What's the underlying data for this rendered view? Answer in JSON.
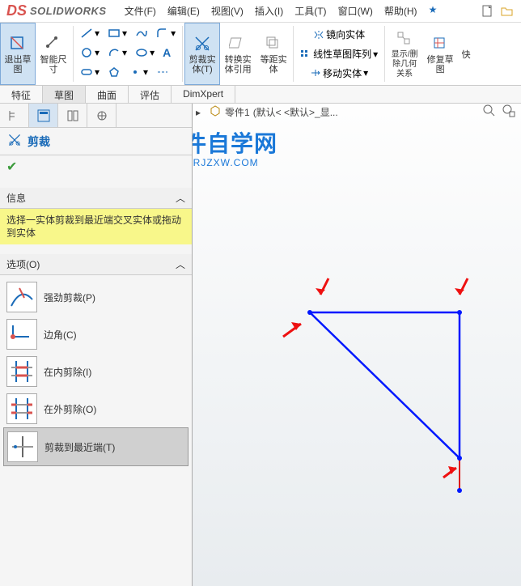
{
  "app": {
    "brand": "SOLIDWORKS"
  },
  "menu": {
    "file": "文件(F)",
    "edit": "编辑(E)",
    "view": "视图(V)",
    "insert": "插入(I)",
    "tools": "工具(T)",
    "window": "窗口(W)",
    "help": "帮助(H)"
  },
  "ribbon": {
    "exit_sketch": "退出草\n图",
    "smart_dim": "智能尺\n寸",
    "trim": "剪裁实\n体(T)",
    "convert": "转换实\n体引用",
    "offset": "等距实\n体",
    "mirror": "镜向实体",
    "linpattern": "线性草图阵列",
    "move": "移动实体",
    "showhide": "显示/删\n除几何\n关系",
    "repair": "修复草\n图",
    "fast": "快"
  },
  "tabs": {
    "feature": "特征",
    "sketch": "草图",
    "surface": "曲面",
    "evaluate": "评估",
    "dimxpert": "DimXpert"
  },
  "breadcrumb": {
    "part": "零件1",
    "config": "(默认< <默认>_显..."
  },
  "pm": {
    "title": "剪裁",
    "info_hdr": "信息",
    "info_msg": "选择一实体剪裁到最近端交叉实体或拖动到实体",
    "opts_hdr": "选项(O)",
    "opts": {
      "power": "强劲剪裁(P)",
      "corner": "边角(C)",
      "trim_in": "在内剪除(I)",
      "trim_out": "在外剪除(O)",
      "nearest": "剪裁到最近端(T)"
    }
  },
  "watermark": {
    "main": "软件自学网",
    "sub": "WWW.RJZXW.COM"
  }
}
